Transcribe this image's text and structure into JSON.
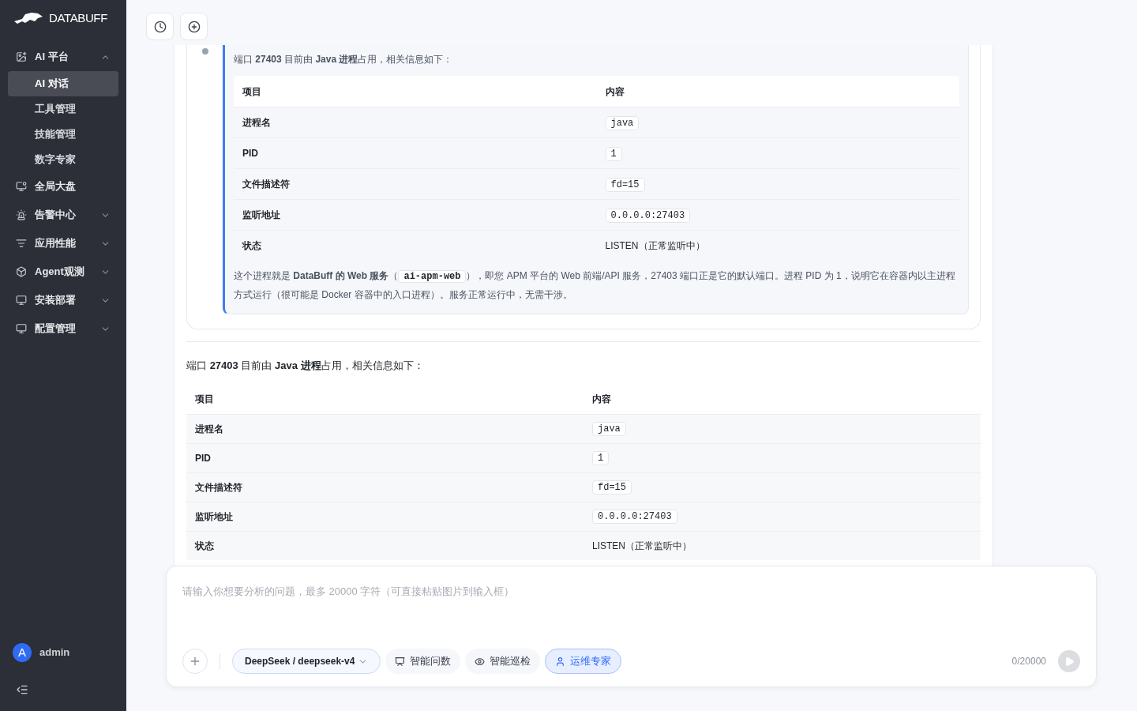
{
  "sidebar": {
    "logo": "DATABUFF",
    "menu": [
      {
        "label": "AI 平台",
        "expanded": true,
        "children": [
          {
            "label": "AI 对话",
            "selected": true
          },
          {
            "label": "工具管理",
            "selected": false
          },
          {
            "label": "技能管理",
            "selected": false
          },
          {
            "label": "数字专家",
            "selected": false
          }
        ]
      },
      {
        "label": "全局大盘"
      },
      {
        "label": "告警中心",
        "expanded": false
      },
      {
        "label": "应用性能",
        "expanded": false
      },
      {
        "label": "Agent观测",
        "expanded": false
      },
      {
        "label": "安装部署",
        "expanded": false
      },
      {
        "label": "配置管理",
        "expanded": false
      }
    ],
    "user": {
      "initial": "A",
      "name": "admin"
    }
  },
  "quote": {
    "intro": "端口 **27403** 目前由 **Java 进程**占用，相关信息如下：",
    "table": {
      "columns": [
        "项目",
        "内容"
      ],
      "rows": [
        {
          "item": "进程名",
          "value": "java",
          "code": true
        },
        {
          "item": "PID",
          "value": "1",
          "code": true
        },
        {
          "item": "文件描述符",
          "value": "fd=15",
          "code": true
        },
        {
          "item": "监听地址",
          "value": "0.0.0.0:27403",
          "code": true
        },
        {
          "item": "状态",
          "value": "LISTEN（正常监听中）",
          "code": false
        }
      ]
    },
    "note": [
      {
        "kind": "text",
        "text": "这个进程就是 **DataBuff 的 Web 服务**（"
      },
      {
        "kind": "code",
        "text": "ai-apm-web"
      },
      {
        "kind": "text",
        "text": "），即您 APM 平台的 Web 前端/API 服务，27403 端口正是它的默认端口。进程 PID 为 1，说明它在容器内以主进程方式运行（很可能是 Docker 容器中的入口进程）。服务正常运行中，无需干涉。"
      }
    ]
  },
  "answer": {
    "intro": "端口 **27403** 目前由 **Java 进程**占用，相关信息如下：",
    "table": {
      "columns": [
        "项目",
        "内容"
      ],
      "rows": [
        {
          "item": "进程名",
          "value": "java",
          "code": true
        },
        {
          "item": "PID",
          "value": "1",
          "code": true
        },
        {
          "item": "文件描述符",
          "value": "fd=15",
          "code": true
        },
        {
          "item": "监听地址",
          "value": "0.0.0.0:27403",
          "code": true
        },
        {
          "item": "状态",
          "value": "LISTEN（正常监听中）",
          "code": false
        }
      ]
    }
  },
  "composer": {
    "placeholder": "请输入你想要分析的问题，最多 20000 字符（可直接粘贴图片到输入框）",
    "model": "DeepSeek / deepseek-v4",
    "modes": [
      {
        "label": "智能问数",
        "selected": false
      },
      {
        "label": "智能巡检",
        "selected": false
      },
      {
        "label": "运维专家",
        "selected": true
      }
    ],
    "count": "0/20000"
  }
}
